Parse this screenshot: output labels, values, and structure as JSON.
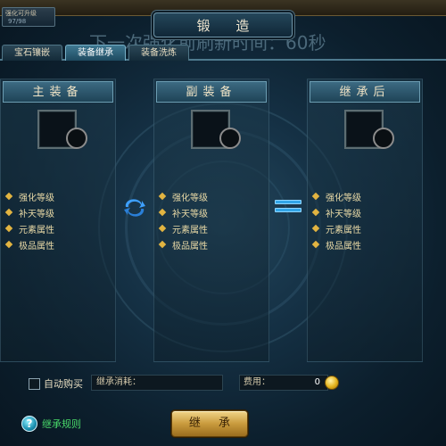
{
  "window": {
    "title": "锻 造",
    "top_mini": {
      "line1": "强化可升级",
      "line2": "97/98"
    },
    "faded_note": "下一次强化前刷新时间：60秒"
  },
  "tabs": [
    {
      "label": "宝石镶嵌",
      "active": false
    },
    {
      "label": "装备继承",
      "active": true
    },
    {
      "label": "装备洗炼",
      "active": false
    }
  ],
  "columns": [
    {
      "title": "主装备",
      "attributes": [
        "强化等级",
        "补天等级",
        "元素属性",
        "极品属性"
      ]
    },
    {
      "title": "副装备",
      "attributes": [
        "强化等级",
        "补天等级",
        "元素属性",
        "极品属性"
      ]
    },
    {
      "title": "继承后",
      "attributes": [
        "强化等级",
        "补天等级",
        "元素属性",
        "极品属性"
      ]
    }
  ],
  "bottom": {
    "auto_buy_label": "自动购买",
    "auto_buy_checked": false,
    "cost_label": "继承消耗：",
    "fee_label": "费用：",
    "fee_value": "0",
    "help_label": "继承规则",
    "inherit_button": "继 承"
  },
  "colors": {
    "accent_gold": "#e2b441",
    "help_green": "#49d96a",
    "equals_blue": "#31a5e8"
  }
}
